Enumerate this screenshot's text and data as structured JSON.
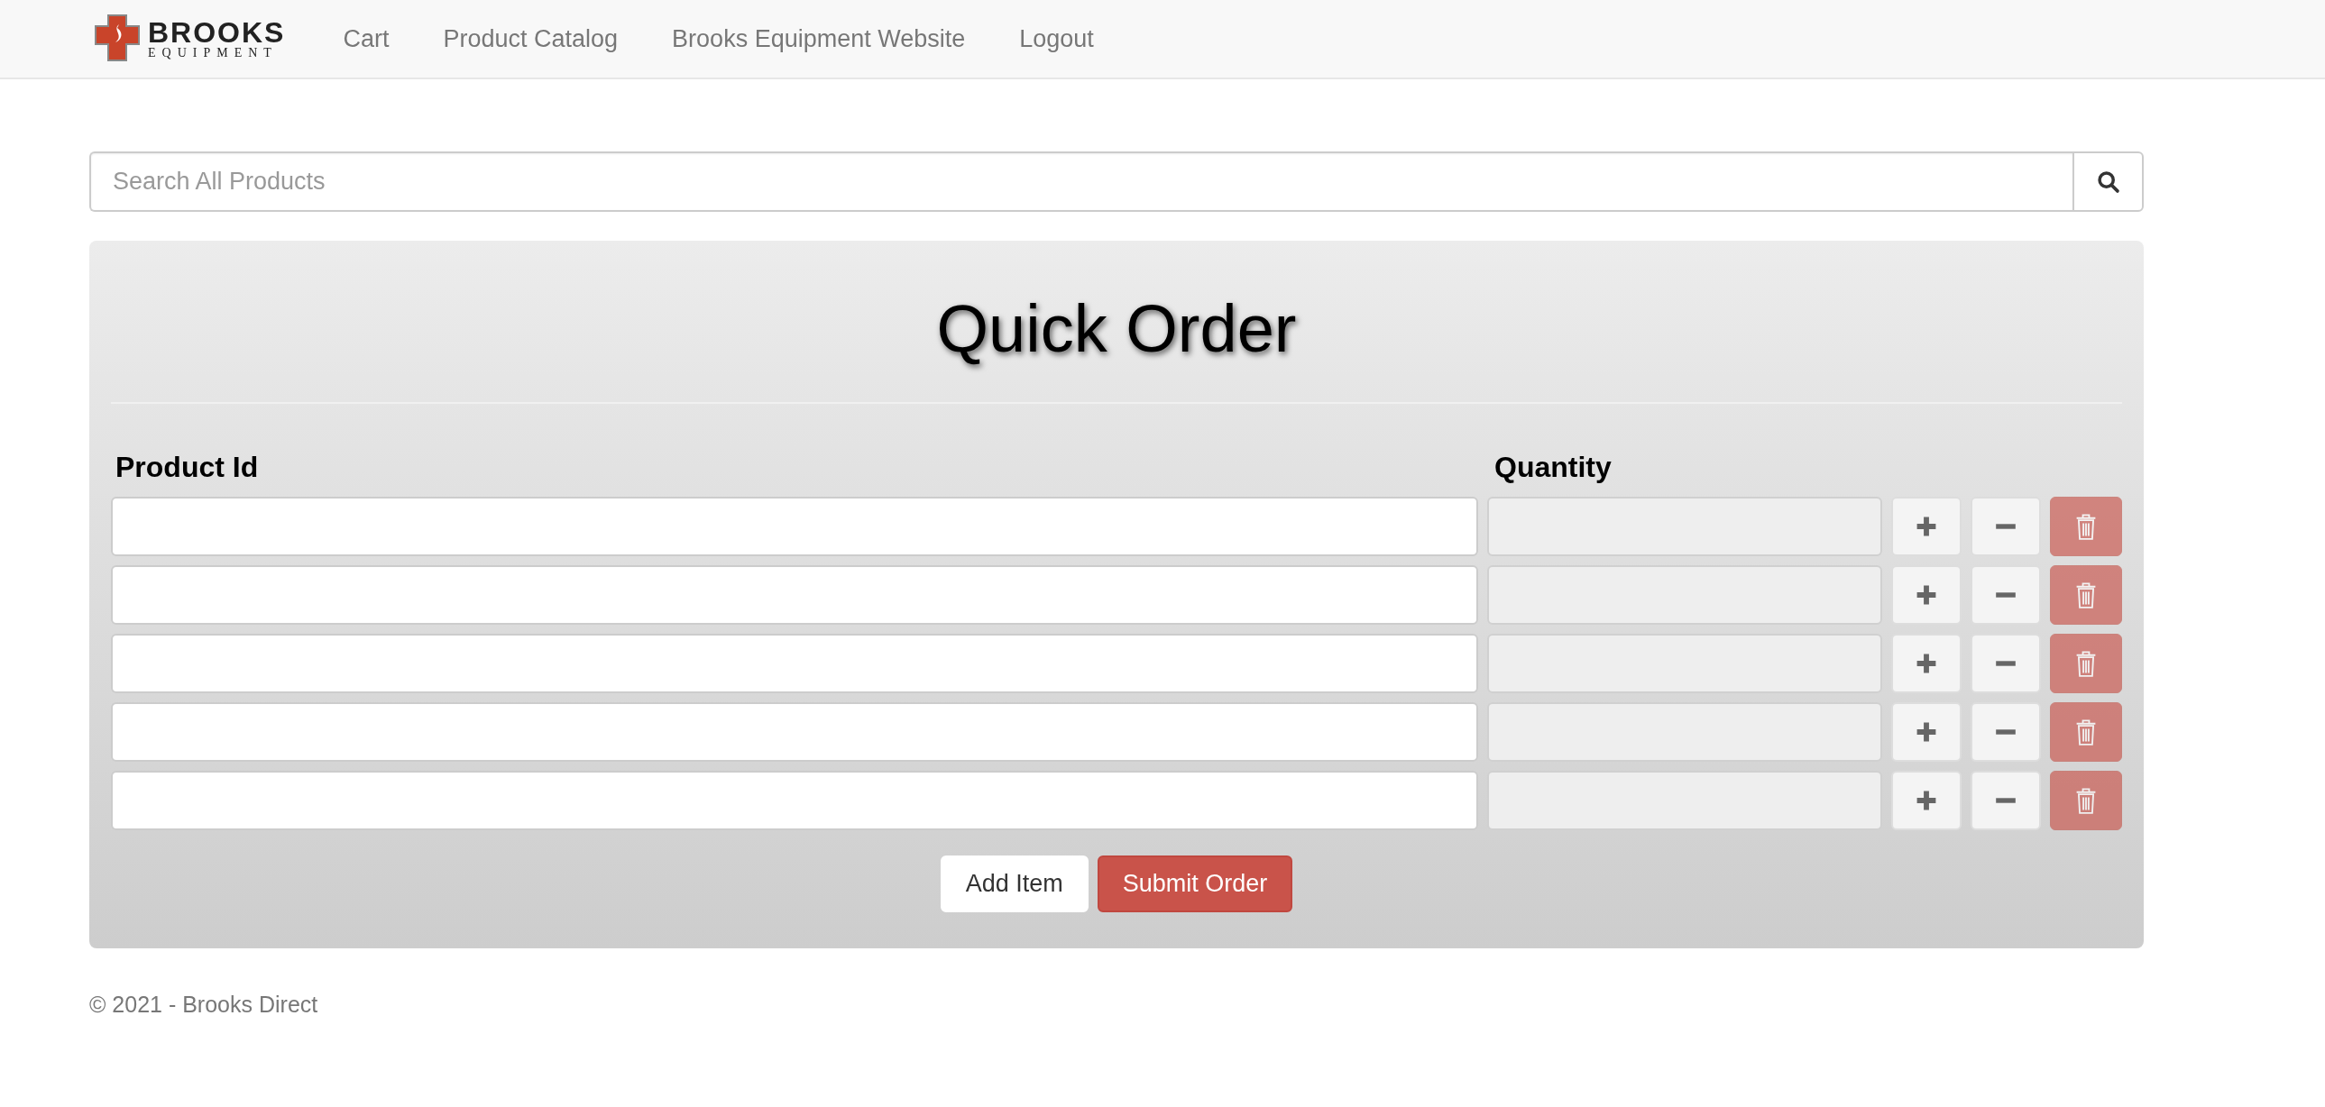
{
  "navbar": {
    "logo": {
      "word": "BROOKS",
      "subword": "EQUIPMENT"
    },
    "links": [
      "Cart",
      "Product Catalog",
      "Brooks Equipment Website",
      "Logout"
    ]
  },
  "search": {
    "placeholder": "Search All Products"
  },
  "quick_order": {
    "title": "Quick Order",
    "columns": [
      "Product Id",
      "Quantity"
    ],
    "rows": [
      {
        "quantity_disabled": true,
        "remove_disabled": true
      },
      {
        "quantity_disabled": true,
        "remove_disabled": true
      },
      {
        "quantity_disabled": true,
        "remove_disabled": true
      },
      {
        "quantity_disabled": true,
        "remove_disabled": true
      },
      {
        "quantity_disabled": true,
        "remove_disabled": true
      }
    ],
    "buttons": [
      {
        "label": "Add Item",
        "kind": "default"
      },
      {
        "label": "Submit Order",
        "kind": "primary"
      }
    ]
  },
  "footer": "© 2021 - Brooks Direct"
}
